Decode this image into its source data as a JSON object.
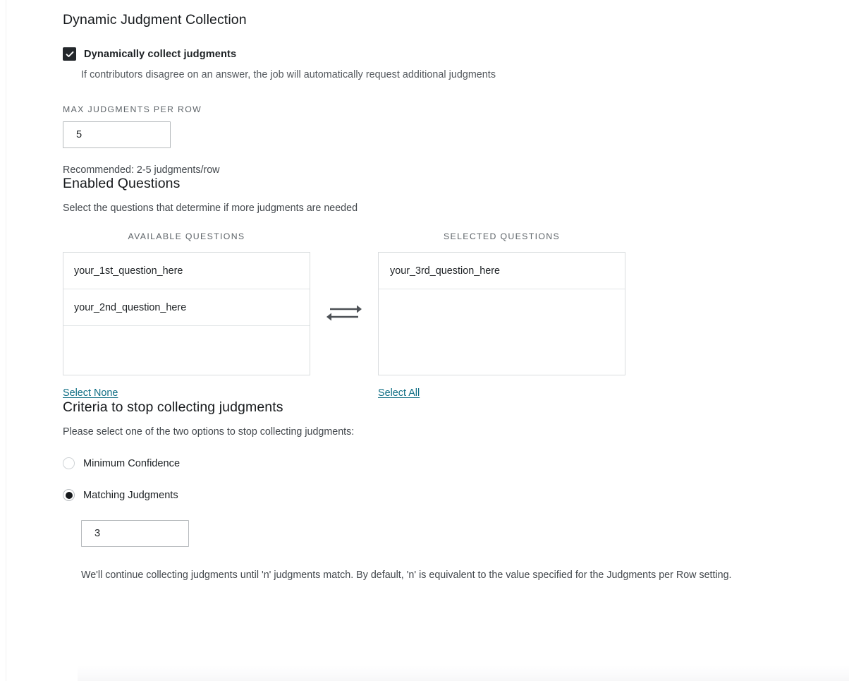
{
  "section": {
    "title": "Dynamic Judgment Collection"
  },
  "dynamic_collect": {
    "checkbox_label": "Dynamically collect judgments",
    "checked": true,
    "help_text": "If contributors disagree on an answer, the job will automatically request additional judgments"
  },
  "max_judgments": {
    "label": "MAX JUDGMENTS PER ROW",
    "value": "5",
    "help_text": "Recommended: 2-5 judgments/row"
  },
  "enabled_questions": {
    "title": "Enabled Questions",
    "description": "Select the questions that determine if more judgments are needed",
    "available": {
      "header": "AVAILABLE QUESTIONS",
      "items": [
        "your_1st_question_here",
        "your_2nd_question_here"
      ],
      "link_label": "Select None"
    },
    "selected": {
      "header": "SELECTED QUESTIONS",
      "items": [
        "your_3rd_question_here"
      ],
      "link_label": "Select All"
    },
    "transfer_icon": "left-right-arrows-icon"
  },
  "criteria": {
    "title": "Criteria to stop collecting judgments",
    "description": "Please select one of the two options to stop collecting judgments:",
    "options": [
      {
        "label": "Minimum Confidence",
        "selected": false
      },
      {
        "label": "Matching Judgments",
        "selected": true
      }
    ],
    "matching_value": "3",
    "help_text": "We'll continue collecting judgments until 'n' judgments match. By default, 'n' is equivalent to the value specified for the Judgments per Row setting."
  },
  "colors": {
    "link": "#0f6e84",
    "checkbox_fill": "#23272b",
    "radio_dot": "#16191c",
    "border": "#b6babd",
    "list_border": "#d9dcde"
  }
}
